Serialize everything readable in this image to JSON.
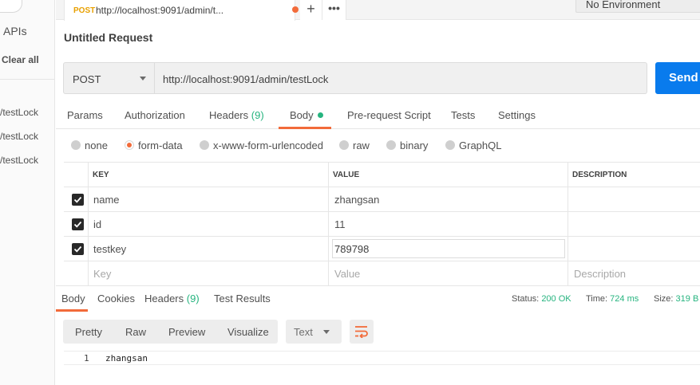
{
  "sidebar": {
    "apis_label": "APIs",
    "clear_all": "Clear all",
    "history": [
      "/testLock",
      "/testLock",
      "/testLock"
    ]
  },
  "tabbar": {
    "request_tab": {
      "method": "POST",
      "url": "http://localhost:9091/admin/t..."
    },
    "plus_icon": "+",
    "more_icon": "•••",
    "environment": "No Environment"
  },
  "request": {
    "title": "Untitled Request",
    "method": "POST",
    "url": "http://localhost:9091/admin/testLock",
    "send_label": "Send"
  },
  "request_tabs": {
    "params": "Params",
    "authorization": "Authorization",
    "headers": "Headers",
    "headers_count": "(9)",
    "body": "Body",
    "pre_request": "Pre-request Script",
    "tests": "Tests",
    "settings": "Settings"
  },
  "body_types": [
    "none",
    "form-data",
    "x-www-form-urlencoded",
    "raw",
    "binary",
    "GraphQL"
  ],
  "params_table": {
    "headers": {
      "key": "KEY",
      "value": "VALUE",
      "description": "DESCRIPTION"
    },
    "rows": [
      {
        "key": "name",
        "value": "zhangsan",
        "checked": true
      },
      {
        "key": "id",
        "value": "11",
        "checked": true
      },
      {
        "key": "testkey",
        "value": "789798",
        "checked": true
      }
    ],
    "placeholder": {
      "key": "Key",
      "value": "Value",
      "description": "Description"
    }
  },
  "response_tabs": {
    "body": "Body",
    "cookies": "Cookies",
    "headers": "Headers",
    "headers_count": "(9)",
    "test_results": "Test Results"
  },
  "response_status": {
    "status_label": "Status:",
    "status_value": "200 OK",
    "time_label": "Time:",
    "time_value": "724 ms",
    "size_label": "Size:",
    "size_value": "319 B"
  },
  "response_toolbar": {
    "pretty": "Pretty",
    "raw": "Raw",
    "preview": "Preview",
    "visualize": "Visualize",
    "format": "Text"
  },
  "response_body": {
    "line_number": "1",
    "content": "zhangsan"
  },
  "colors": {
    "accent": "#f26b3a",
    "send": "#097bed",
    "success": "#26b47f",
    "post_method": "#e8a000"
  }
}
